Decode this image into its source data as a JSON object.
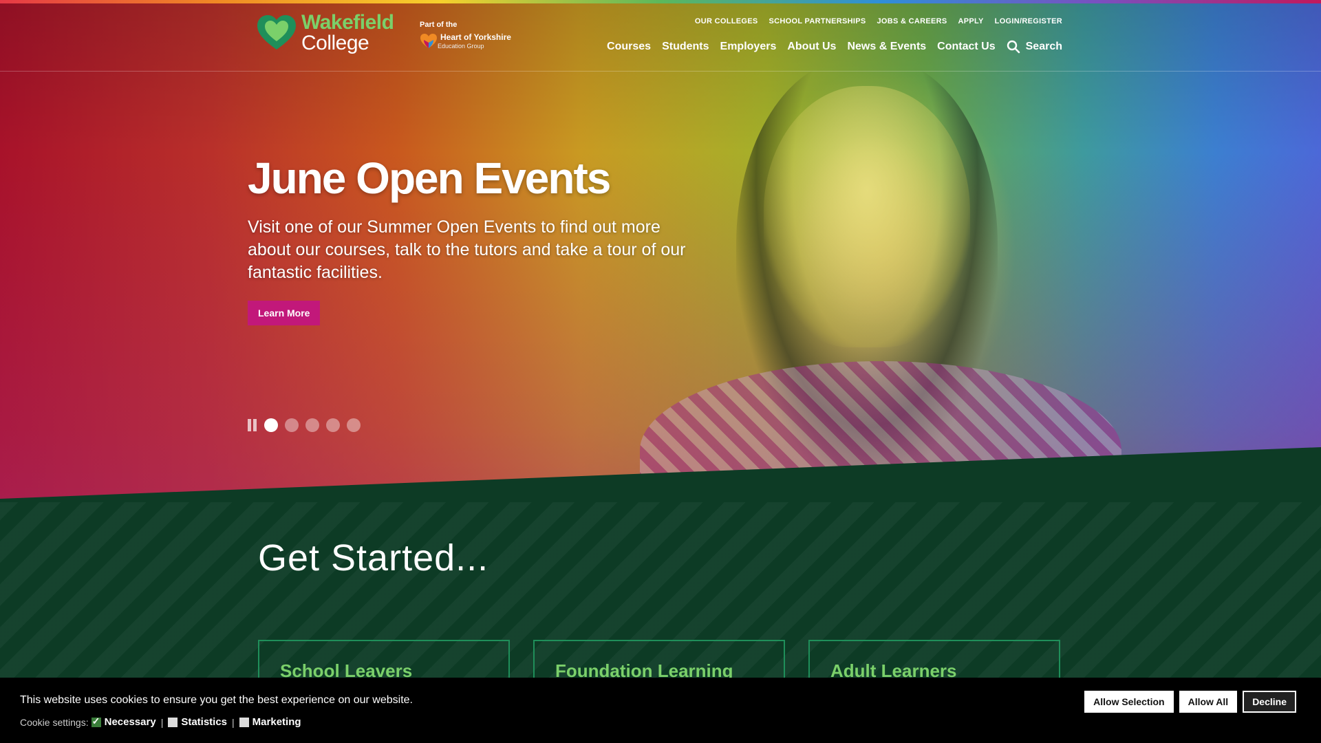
{
  "brand": {
    "line1": "Wakefield",
    "line2": "College",
    "partner_prefix": "Part of the",
    "partner_name": "Heart of Yorkshire",
    "partner_sub": "Education Group"
  },
  "top_links": [
    "OUR COLLEGES",
    "SCHOOL PARTNERSHIPS",
    "JOBS & CAREERS",
    "APPLY",
    "LOGIN/REGISTER"
  ],
  "main_nav": [
    "Courses",
    "Students",
    "Employers",
    "About Us",
    "News & Events",
    "Contact Us"
  ],
  "search_label": "Search",
  "hero": {
    "title": "June Open Events",
    "text": "Visit one of our Summer Open Events to find out more about our courses, talk to the tutors and take a tour of our fantastic facilities.",
    "button": "Learn More"
  },
  "slider": {
    "count": 5,
    "active": 1
  },
  "get_started": {
    "title": "Get Started...",
    "cards": [
      "School Leavers",
      "Foundation Learning",
      "Adult Learners"
    ]
  },
  "cookie": {
    "message": "This website uses cookies to ensure you get the best experience on our website.",
    "settings_label": "Cookie settings:",
    "options": [
      {
        "label": "Necessary",
        "checked": true
      },
      {
        "label": "Statistics",
        "checked": false
      },
      {
        "label": "Marketing",
        "checked": false
      }
    ],
    "buttons": [
      "Allow Selection",
      "Allow All",
      "Decline"
    ]
  },
  "colors": {
    "brand_green": "#7bd06a",
    "dark_green": "#0d3b25",
    "accent_magenta": "#c2187a"
  }
}
